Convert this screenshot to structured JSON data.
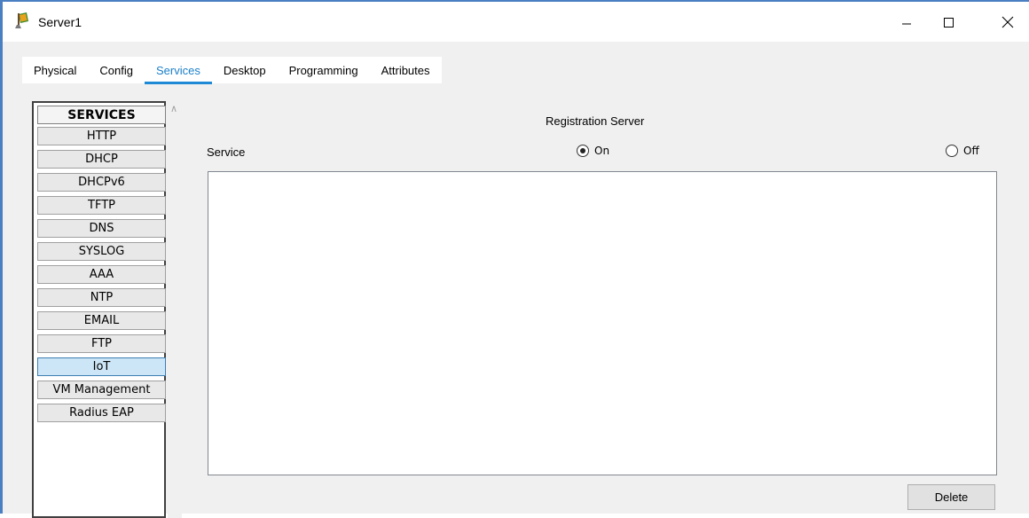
{
  "window": {
    "title": "Server1"
  },
  "tabs": [
    {
      "label": "Physical"
    },
    {
      "label": "Config"
    },
    {
      "label": "Services",
      "active": true
    },
    {
      "label": "Desktop"
    },
    {
      "label": "Programming"
    },
    {
      "label": "Attributes"
    }
  ],
  "services": {
    "header": "SERVICES",
    "items": [
      {
        "label": "HTTP"
      },
      {
        "label": "DHCP"
      },
      {
        "label": "DHCPv6"
      },
      {
        "label": "TFTP"
      },
      {
        "label": "DNS"
      },
      {
        "label": "SYSLOG"
      },
      {
        "label": "AAA"
      },
      {
        "label": "NTP"
      },
      {
        "label": "EMAIL"
      },
      {
        "label": "FTP"
      },
      {
        "label": "IoT",
        "selected": true
      },
      {
        "label": "VM Management"
      },
      {
        "label": "Radius EAP"
      }
    ]
  },
  "panel": {
    "title": "Registration Server",
    "service_label": "Service",
    "on_label": "On",
    "off_label": "Off",
    "selected": "On",
    "delete_label": "Delete"
  },
  "colors": {
    "accent": "#1e8ad6",
    "selected_bg": "#cde6f7",
    "border_blue": "#4a7fc1"
  },
  "icons": {
    "app": "server-app-icon",
    "minimize": "minimize-icon",
    "maximize": "maximize-icon",
    "close": "close-icon"
  }
}
